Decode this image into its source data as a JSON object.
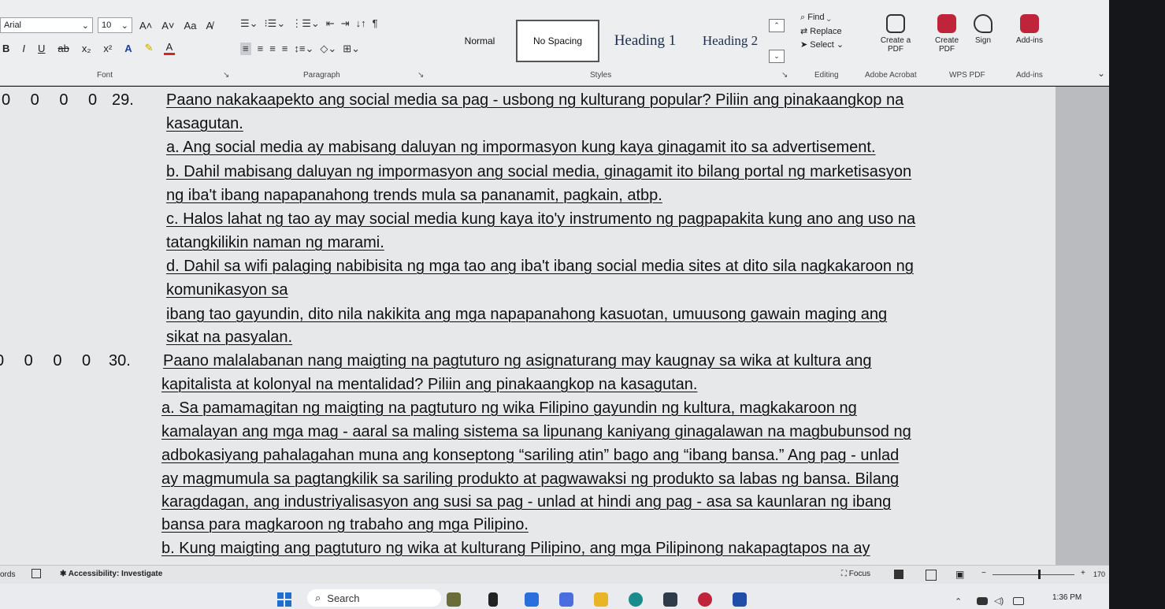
{
  "ribbon": {
    "font": {
      "name": "Arial",
      "size": "10",
      "label": "Font",
      "grow_glyph": "A˄",
      "shrink_glyph": "A˅",
      "case_glyph": "Aa",
      "bold": "B",
      "italic": "I",
      "underline": "U",
      "strike": "ab",
      "subscript": "x₂",
      "superscript": "x²",
      "font_color": "A"
    },
    "paragraph": {
      "label": "Paragraph",
      "sort_glyph": "↓↑",
      "pilcrow": "¶"
    },
    "styles": {
      "label": "Styles",
      "items": [
        "Normal",
        "No Spacing",
        "Heading 1",
        "Heading 2"
      ]
    },
    "editing": {
      "label": "Editing",
      "find": "Find",
      "replace": "Replace",
      "select": "Select"
    },
    "acrobat": {
      "label": "Adobe Acrobat",
      "create_pdf": "Create a PDF"
    },
    "wps": {
      "label": "WPS PDF",
      "create_pdf": "Create PDF",
      "sign": "Sign"
    },
    "addins": {
      "label": "Add-ins",
      "button": "Add-ins"
    }
  },
  "document": {
    "q29": {
      "bubbles": "0 0 0 0",
      "number": "29.",
      "lines": [
        "Paano nakakaapekto ang social media sa pag - usbong ng kulturang popular? Piliin ang pinakaangkop na",
        "kasagutan.",
        "a. Ang social media ay mabisang daluyan ng impormasyon kung kaya ginagamit ito sa advertisement.",
        "b. Dahil mabisang daluyan ng impormasyon ang social media, ginagamit ito bilang portal ng marketisasyon",
        "ng iba't ibang napapanahong trends mula sa pananamit, pagkain, atbp.",
        "c. Halos lahat ng tao ay may social media kung kaya ito'y instrumento ng pagpapakita kung ano ang uso na",
        "tatangkilikin naman ng marami.",
        "d. Dahil sa wifi palaging nabibisita ng mga tao ang iba't ibang social media sites at dito sila nagkakaroon ng",
        "komunikasyon sa",
        "ibang tao gayundin, dito nila nakikita ang mga napapanahong kasuotan, umuusong gawain maging ang",
        "sikat na pasyalan."
      ]
    },
    "q30": {
      "bubbles": "0 0 0 0",
      "number": "30.",
      "lines": [
        "Paano malalabanan nang maigting na pagtuturo ng asignaturang may kaugnay sa wika at kultura ang",
        "kapitalista at kolonyal na mentalidad? Piliin ang pinakaangkop na kasagutan.",
        "a. Sa pamamagitan ng maigting na pagtuturo ng wika Filipino gayundin ng kultura, magkakaroon ng",
        "kamalayan ang mga mag - aaral sa maling sistema sa lipunang kaniyang ginagalawan na magbubunsod ng",
        "adbokasiyang pahalagahan muna ang konseptong “sariling atin” bago ang “ibang bansa.” Ang pag - unlad",
        "ay magmumula sa pagtangkilik sa sariling produkto at pagwawaksi ng produkto sa labas ng bansa. Bilang",
        "karagdagan, ang industriyalisasyon ang susi sa pag - unlad at hindi ang pag - asa sa kaunlaran ng ibang",
        "bansa para magkaroon ng trabaho ang mga Pilipino.",
        "b. Kung maigting ang pagtuturo ng wika at kulturang Pilipino, ang mga Pilipinong nakapagtapos na ay"
      ]
    }
  },
  "status": {
    "words": "ords",
    "accessibility": "Accessibility: Investigate",
    "focus": "Focus",
    "zoom": "170"
  },
  "taskbar": {
    "search_placeholder": "Search",
    "time": "1:36 PM"
  },
  "colors": {
    "ribbon_bg": "#eceef0",
    "doc_bg": "#e6e8ea",
    "text": "#111111"
  }
}
